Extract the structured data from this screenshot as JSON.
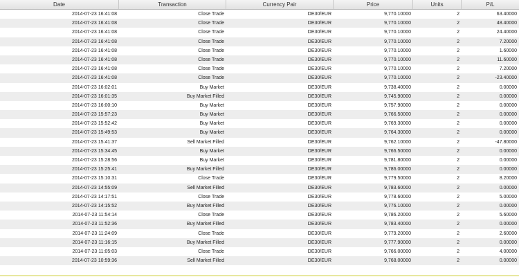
{
  "columns": [
    "Date",
    "Transaction",
    "Currency Pair",
    "Price",
    "Units",
    "P/L"
  ],
  "rows": [
    [
      "2014-07-23 16:41:08",
      "Close Trade",
      "DE30/EUR",
      "9,770.10000",
      "2",
      "63.40000"
    ],
    [
      "2014-07-23 16:41:08",
      "Close Trade",
      "DE30/EUR",
      "9,770.10000",
      "2",
      "48.40000"
    ],
    [
      "2014-07-23 16:41:08",
      "Close Trade",
      "DE30/EUR",
      "9,770.10000",
      "2",
      "24.40000"
    ],
    [
      "2014-07-23 16:41:08",
      "Close Trade",
      "DE30/EUR",
      "9,770.10000",
      "2",
      "7.20000"
    ],
    [
      "2014-07-23 16:41:08",
      "Close Trade",
      "DE30/EUR",
      "9,770.10000",
      "2",
      "1.60000"
    ],
    [
      "2014-07-23 16:41:08",
      "Close Trade",
      "DE30/EUR",
      "9,770.10000",
      "2",
      "11.60000"
    ],
    [
      "2014-07-23 16:41:08",
      "Close Trade",
      "DE30/EUR",
      "9,770.10000",
      "2",
      "7.20000"
    ],
    [
      "2014-07-23 16:41:08",
      "Close Trade",
      "DE30/EUR",
      "9,770.10000",
      "2",
      "-23.40000"
    ],
    [
      "2014-07-23 16:02:01",
      "Buy Market",
      "DE30/EUR",
      "9,738.40000",
      "2",
      "0.00000"
    ],
    [
      "2014-07-23 16:01:35",
      "Buy Market Filled",
      "DE30/EUR",
      "9,745.90000",
      "2",
      "0.00000"
    ],
    [
      "2014-07-23 16:00:10",
      "Buy Market",
      "DE30/EUR",
      "9,757.90000",
      "2",
      "0.00000"
    ],
    [
      "2014-07-23 15:57:23",
      "Buy Market",
      "DE30/EUR",
      "9,766.50000",
      "2",
      "0.00000"
    ],
    [
      "2014-07-23 15:52:42",
      "Buy Market",
      "DE30/EUR",
      "9,769.30000",
      "2",
      "0.00000"
    ],
    [
      "2014-07-23 15:49:53",
      "Buy Market",
      "DE30/EUR",
      "9,764.30000",
      "2",
      "0.00000"
    ],
    [
      "2014-07-23 15:41:37",
      "Sell Market Filled",
      "DE30/EUR",
      "9,762.10000",
      "2",
      "-47.80000"
    ],
    [
      "2014-07-23 15:34:45",
      "Buy Market",
      "DE30/EUR",
      "9,766.50000",
      "2",
      "0.00000"
    ],
    [
      "2014-07-23 15:28:56",
      "Buy Market",
      "DE30/EUR",
      "9,781.80000",
      "2",
      "0.00000"
    ],
    [
      "2014-07-23 15:25:41",
      "Buy Market Filled",
      "DE30/EUR",
      "9,786.00000",
      "2",
      "0.00000"
    ],
    [
      "2014-07-23 15:10:31",
      "Close Trade",
      "DE30/EUR",
      "9,779.50000",
      "2",
      "8.20000"
    ],
    [
      "2014-07-23 14:55:09",
      "Sell Market Filled",
      "DE30/EUR",
      "9,783.60000",
      "2",
      "0.00000"
    ],
    [
      "2014-07-23 14:17:51",
      "Close Trade",
      "DE30/EUR",
      "9,778.60000",
      "2",
      "5.00000"
    ],
    [
      "2014-07-23 14:15:52",
      "Buy Market Filled",
      "DE30/EUR",
      "9,776.10000",
      "2",
      "0.00000"
    ],
    [
      "2014-07-23 11:54:14",
      "Close Trade",
      "DE30/EUR",
      "9,786.20000",
      "2",
      "5.60000"
    ],
    [
      "2014-07-23 11:52:36",
      "Buy Market Filled",
      "DE30/EUR",
      "9,783.40000",
      "2",
      "0.00000"
    ],
    [
      "2014-07-23 11:24:09",
      "Close Trade",
      "DE30/EUR",
      "9,779.20000",
      "2",
      "2.60000"
    ],
    [
      "2014-07-23 11:16:15",
      "Buy Market Filled",
      "DE30/EUR",
      "9,777.90000",
      "2",
      "0.00000"
    ],
    [
      "2014-07-23 11:05:03",
      "Close Trade",
      "DE30/EUR",
      "9,766.00000",
      "2",
      "4.00000"
    ],
    [
      "2014-07-23 10:59:36",
      "Sell Market Filled",
      "DE30/EUR",
      "9,768.00000",
      "2",
      "0.00000"
    ]
  ]
}
